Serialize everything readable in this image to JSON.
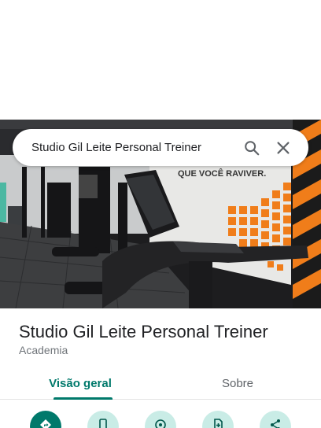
{
  "search": {
    "query": "Studio Gil Leite Personal Treiner"
  },
  "place": {
    "name": "Studio Gil Leite Personal Treiner",
    "category": "Academia",
    "photo_wall_text": "QUE VOCÊ RAVIVER."
  },
  "tabs": [
    {
      "label": "Visão geral",
      "active": true
    },
    {
      "label": "Sobre",
      "active": false
    }
  ],
  "actions": [
    {
      "icon": "directions-icon",
      "style": "primary"
    },
    {
      "icon": "phone-icon",
      "style": "secondary"
    },
    {
      "icon": "location-icon",
      "style": "secondary"
    },
    {
      "icon": "save-icon",
      "style": "secondary"
    },
    {
      "icon": "share-icon",
      "style": "secondary"
    }
  ],
  "colors": {
    "accent": "#00796b",
    "accent_light": "#c9ece6",
    "wall_orange": "#f07d1a"
  }
}
